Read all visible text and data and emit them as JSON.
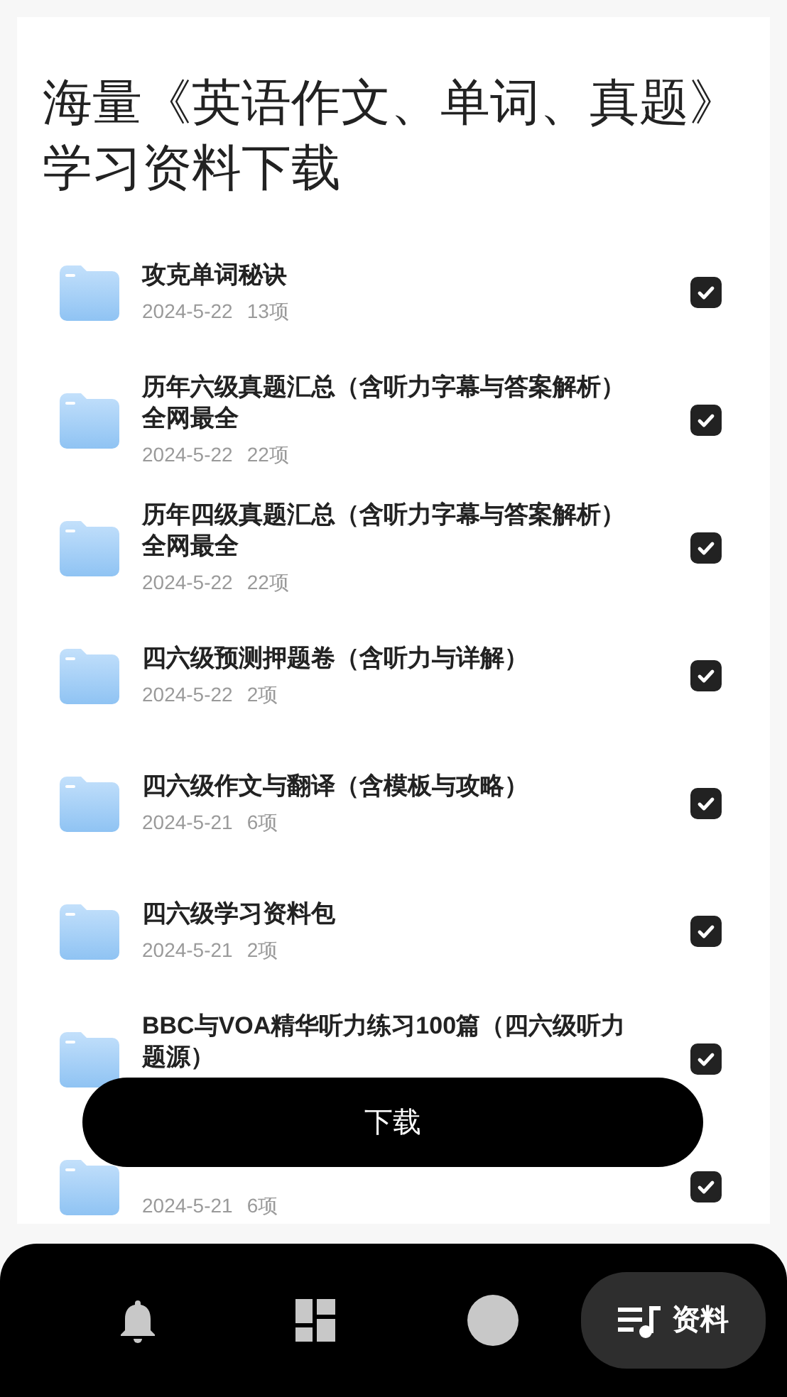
{
  "title": "海量《英语作文、单词、真题》学习资料下载",
  "files": [
    {
      "title": "攻克单词秘诀",
      "date": "2024-5-22",
      "count": "13项",
      "checked": true
    },
    {
      "title": "历年六级真题汇总（含听力字幕与答案解析）全网最全",
      "date": "2024-5-22",
      "count": "22项",
      "checked": true
    },
    {
      "title": "历年四级真题汇总（含听力字幕与答案解析）全网最全",
      "date": "2024-5-22",
      "count": "22项",
      "checked": true
    },
    {
      "title": "四六级预测押题卷（含听力与详解）",
      "date": "2024-5-22",
      "count": "2项",
      "checked": true
    },
    {
      "title": "四六级作文与翻译（含模板与攻略）",
      "date": "2024-5-21",
      "count": "6项",
      "checked": true
    },
    {
      "title": "四六级学习资料包",
      "date": "2024-5-21",
      "count": "2项",
      "checked": true
    },
    {
      "title": "BBC与VOA精华听力练习100篇（四六级听力题源）",
      "checked": true
    },
    {
      "date": "2024-5-21",
      "count": "6项",
      "checked": true
    }
  ],
  "download_button": "下载",
  "tabs": [
    {
      "kind": "bell",
      "selected": false
    },
    {
      "kind": "grid",
      "selected": false
    },
    {
      "kind": "avatar",
      "selected": false
    },
    {
      "kind": "library",
      "label": "资料",
      "selected": true
    }
  ]
}
